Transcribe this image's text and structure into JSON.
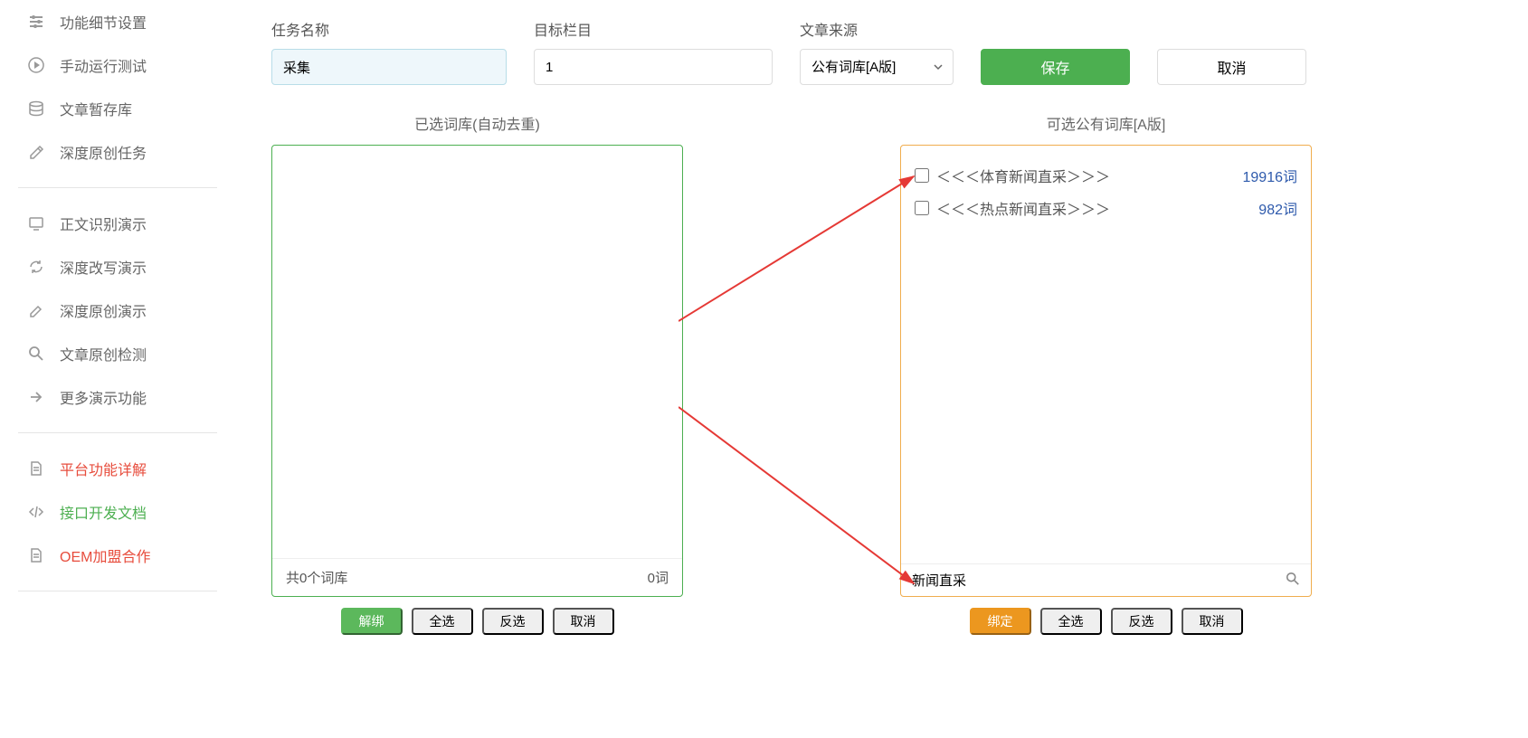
{
  "sidebar": {
    "items": [
      {
        "label": "功能细节设置"
      },
      {
        "label": "手动运行测试"
      },
      {
        "label": "文章暂存库"
      },
      {
        "label": "深度原创任务"
      }
    ],
    "demos": [
      {
        "label": "正文识别演示"
      },
      {
        "label": "深度改写演示"
      },
      {
        "label": "深度原创演示"
      },
      {
        "label": "文章原创检测"
      },
      {
        "label": "更多演示功能"
      }
    ],
    "docs": [
      {
        "label": "平台功能详解",
        "style": "red"
      },
      {
        "label": "接口开发文档",
        "style": "green"
      },
      {
        "label": "OEM加盟合作",
        "style": "red"
      }
    ]
  },
  "form": {
    "taskName": {
      "label": "任务名称",
      "value": "采集"
    },
    "target": {
      "label": "目标栏目",
      "value": "1"
    },
    "source": {
      "label": "文章来源",
      "value": "公有词库[A版]"
    },
    "saveBtn": "保存",
    "cancelBtn": "取消"
  },
  "leftPanel": {
    "title": "已选词库(自动去重)",
    "footer_left": "共0个词库",
    "footer_right": "0词",
    "buttons": {
      "unbind": "解绑",
      "selectAll": "全选",
      "invert": "反选",
      "cancel": "取消"
    }
  },
  "rightPanel": {
    "title": "可选公有词库[A版]",
    "items": [
      {
        "label": "＜＜＜体育新闻直采＞＞＞",
        "count": "19916词"
      },
      {
        "label": "＜＜＜热点新闻直采＞＞＞",
        "count": "982词"
      }
    ],
    "search": "新闻直采",
    "buttons": {
      "bind": "绑定",
      "selectAll": "全选",
      "invert": "反选",
      "cancel": "取消"
    }
  }
}
